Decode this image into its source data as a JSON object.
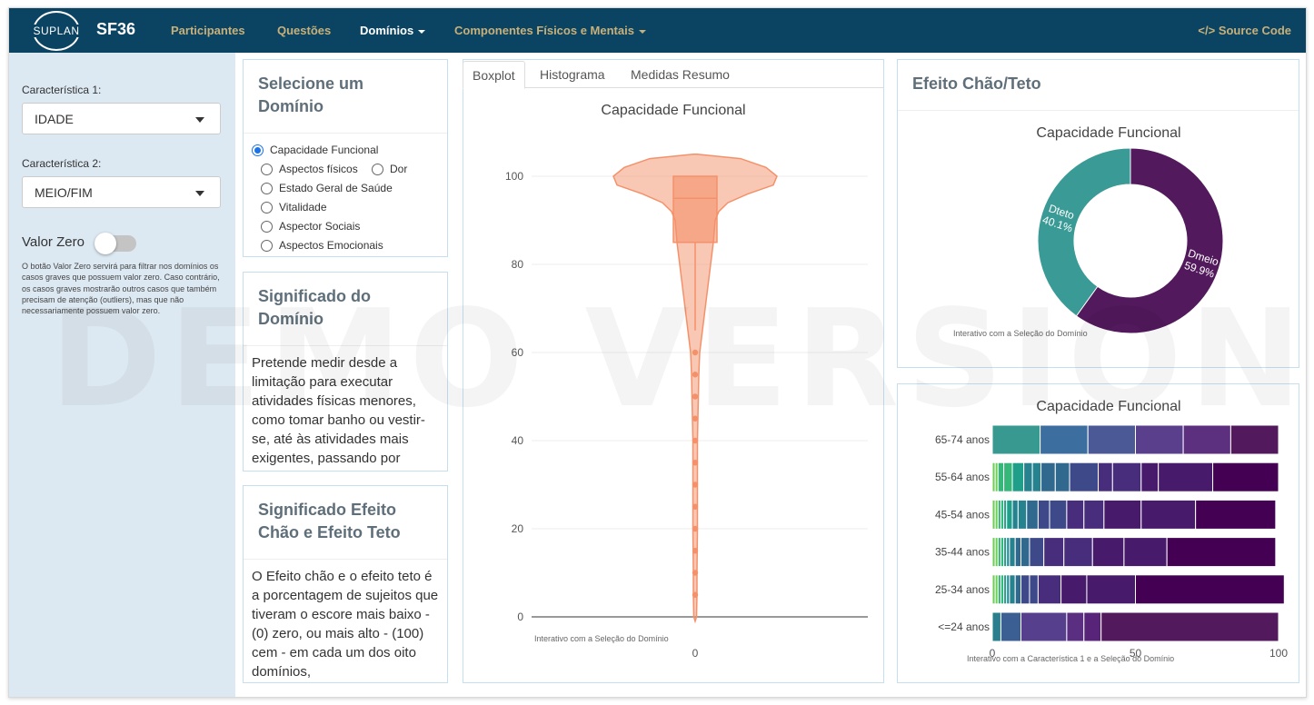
{
  "navbar": {
    "logo_text": "SUPLAN",
    "brand": "SF36",
    "items": [
      "Participantes",
      "Questões",
      "Domínios",
      "Componentes Físicos e Mentais"
    ],
    "source": "Source Code"
  },
  "sidebar": {
    "char1_label": "Característica 1:",
    "char1_value": "IDADE",
    "char2_label": "Característica 2:",
    "char2_value": "MEIO/FIM",
    "zero_label": "Valor Zero",
    "zero_on": false,
    "help": "O botão Valor Zero servirá para filtrar nos domínios os casos graves que possuem valor zero. Caso contrário, os casos graves mostrarão outros casos que também precisam de atenção (outliers), mas que não necessariamente possuem valor zero."
  },
  "domain_select": {
    "title": "Selecione um Domínio",
    "options": [
      "Capacidade Funcional",
      "Aspectos físicos",
      "Dor",
      "Estado Geral de Saúde",
      "Vitalidade",
      "Aspector Sociais",
      "Aspectos Emocionais"
    ],
    "selected": "Capacidade Funcional"
  },
  "meaning": {
    "title": "Significado do Domínio",
    "text": "Pretende medir desde a limitação para executar atividades físicas menores, como tomar banho ou vestir-se, até às atividades mais exigentes, passando por"
  },
  "floor_ceiling_meaning": {
    "title": "Significado Efeito Chão e Efeito Teto",
    "text": "O Efeito chão e o efeito teto é a porcentagem de sujeitos que tiveram o escore mais baixo - (0) zero, ou mais alto - (100) cem - em cada um dos oito domínios,"
  },
  "tabs": [
    "Boxplot",
    "Histograma",
    "Medidas Resumo"
  ],
  "active_tab": "Boxplot",
  "floor_ceiling": {
    "title": "Efeito Chão/Teto"
  },
  "watermark": "DEMO VERSION",
  "chart_data": [
    {
      "type": "violin",
      "title": "Capacidade Funcional",
      "x_tick": "0",
      "ylim": [
        0,
        105
      ],
      "y_ticks": [
        0,
        20,
        40,
        60,
        80,
        100
      ],
      "box": {
        "q1": 85,
        "median": 95,
        "q3": 100,
        "whisker_low": 65,
        "whisker_high": 100
      },
      "outliers": [
        60,
        55,
        50,
        45,
        40,
        35,
        30,
        25,
        20,
        15,
        10,
        5
      ],
      "color": "#f4916a",
      "note": "Interativo com a Seleção do Domínio"
    },
    {
      "type": "pie",
      "title": "Capacidade Funcional",
      "labels": [
        "Dteto",
        "Dmeio"
      ],
      "values": [
        40.1,
        59.9
      ],
      "value_labels": [
        "40.1%",
        "59.9%"
      ],
      "colors": [
        "#3a9a95",
        "#521a5c"
      ],
      "note": "Interativo com a Seleção do Domínio"
    },
    {
      "type": "bar",
      "orientation": "horizontal",
      "stacked": true,
      "title": "Capacidade Funcional",
      "categories": [
        "65-74 anos",
        "55-64 anos",
        "45-54 anos",
        "35-44 anos",
        "25-34 anos",
        "<=24 anos"
      ],
      "xlim": [
        0,
        100
      ],
      "x_ticks": [
        0,
        50,
        100
      ],
      "segments": [
        [
          16.7,
          16.7,
          16.6,
          16.7,
          16.6,
          16.7
        ],
        [
          1,
          1,
          2,
          3,
          4,
          3,
          3,
          5,
          5,
          10,
          5,
          10,
          6,
          19,
          23
        ],
        [
          1,
          1,
          1,
          1,
          1,
          2,
          2,
          3,
          4,
          4,
          6,
          6,
          7,
          13,
          19,
          28
        ],
        [
          1,
          1,
          1,
          1,
          1,
          1,
          2,
          2,
          3,
          5,
          7,
          10,
          11,
          15,
          38
        ],
        [
          1,
          1,
          1,
          1,
          1,
          1,
          2,
          2,
          3,
          3,
          8,
          9,
          17,
          52
        ],
        [
          3,
          7,
          16,
          6,
          6,
          62
        ]
      ],
      "note": "Interativo com a Característica 1 e a Seleção do Domínio"
    }
  ]
}
